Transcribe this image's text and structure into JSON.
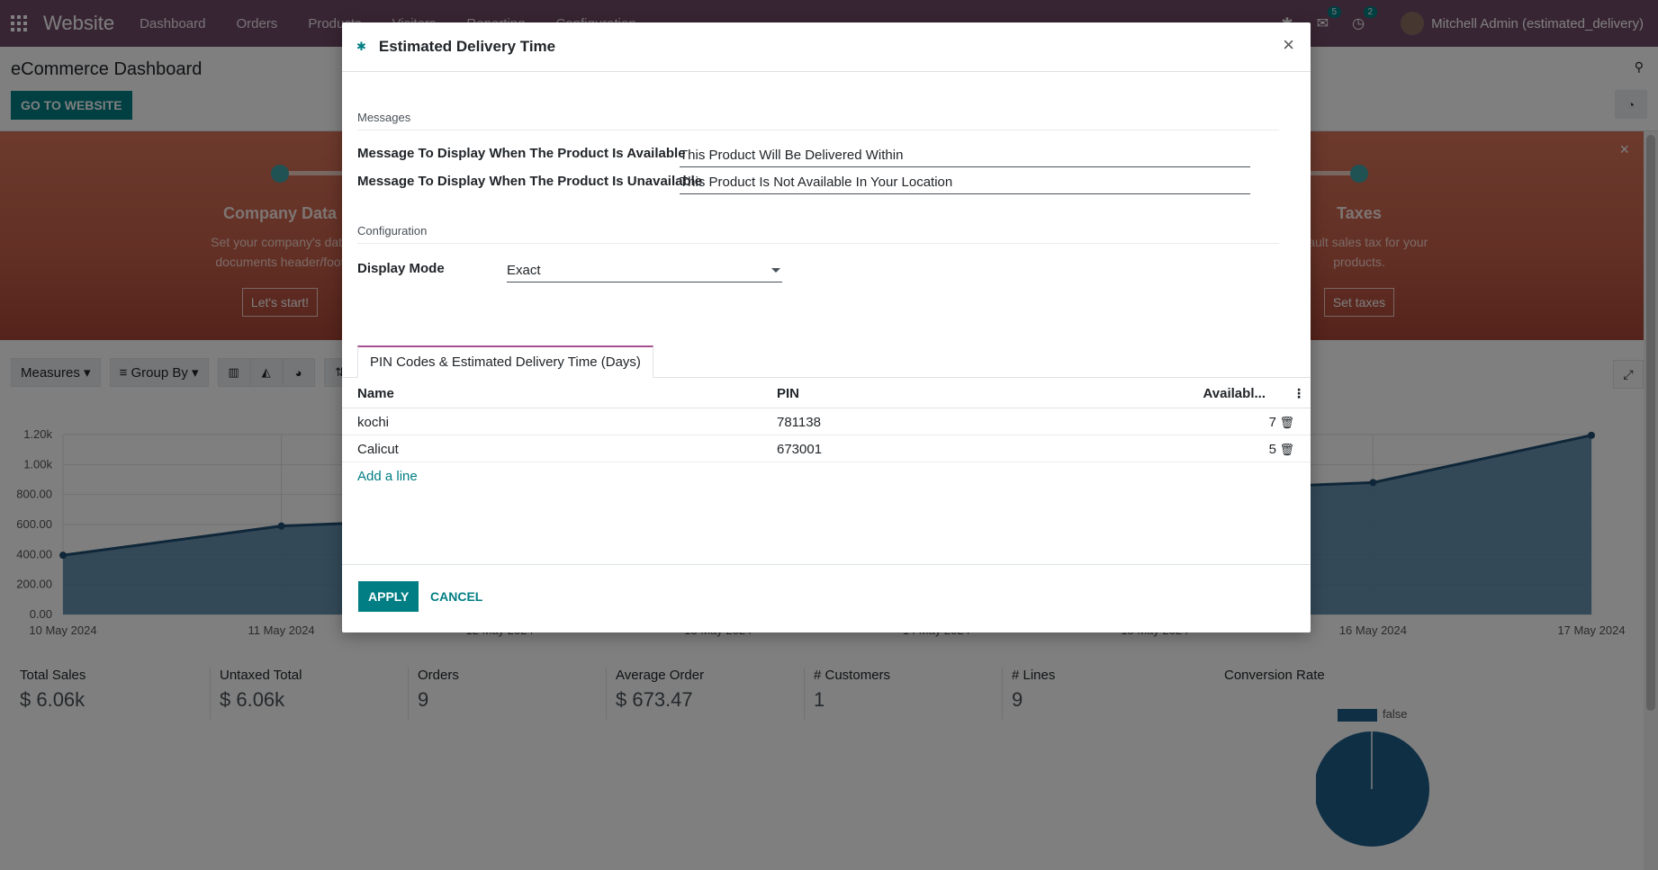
{
  "navbar": {
    "brand": "Website",
    "menu": [
      "Dashboard",
      "Orders",
      "Products",
      "Visitors",
      "Reporting",
      "Configuration"
    ],
    "messages_badge": "5",
    "activity_badge": "2",
    "user": "Mitchell Admin (estimated_delivery)"
  },
  "control_panel": {
    "title": "eCommerce Dashboard",
    "go_to_website": "GO TO WEBSITE"
  },
  "onboarding": {
    "steps": [
      {
        "title": "Company Data",
        "desc_line1": "Set your company's data",
        "desc_line2": "documents header/foot",
        "button": "Let's start!"
      },
      {
        "title": "Taxes",
        "desc_line1": "default sales tax for your",
        "desc_line2": "products.",
        "button": "Set taxes"
      }
    ]
  },
  "toolbar": {
    "measures": "Measures",
    "group_by": "Group By"
  },
  "chart_data": {
    "type": "area",
    "x": [
      "10 May 2024",
      "11 May 2024",
      "12 May 2024",
      "13 May 2024",
      "14 May 2024",
      "15 May 2024",
      "16 May 2024",
      "17 May 2024"
    ],
    "y_ticks": [
      "0.00",
      "200.00",
      "400.00",
      "600.00",
      "800.00",
      "1.00k",
      "1.20k"
    ],
    "ylim": [
      0,
      1200
    ],
    "series": [
      {
        "values": [
          395,
          590,
          null,
          null,
          null,
          null,
          880,
          1195
        ]
      }
    ],
    "color": "#4c7fa3"
  },
  "kpis": [
    {
      "label": "Total Sales",
      "value": "$ 6.06k"
    },
    {
      "label": "Untaxed Total",
      "value": "$ 6.06k"
    },
    {
      "label": "Orders",
      "value": "9"
    },
    {
      "label": "Average Order",
      "value": "$ 673.47"
    },
    {
      "label": "# Customers",
      "value": "1"
    },
    {
      "label": "# Lines",
      "value": "9"
    },
    {
      "label": "Conversion Rate",
      "value": ""
    }
  ],
  "pie": {
    "legend_label": "false",
    "color": "#1f5f8b"
  },
  "modal": {
    "title": "Estimated Delivery Time",
    "messages_section": "Messages",
    "available_label": "Message To Display When The Product Is Available",
    "available_value": "This Product Will Be Delivered Within",
    "unavailable_label": "Message To Display When The Product Is Unavailable",
    "unavailable_value": "This Product Is Not Available In Your Location",
    "configuration_section": "Configuration",
    "display_mode_label": "Display Mode",
    "display_mode_value": "Exact",
    "tab_label": "PIN Codes & Estimated Delivery Time (Days)",
    "columns": {
      "name": "Name",
      "pin": "PIN",
      "avail": "Availabl..."
    },
    "rows": [
      {
        "name": "kochi",
        "pin": "781138",
        "days": "7"
      },
      {
        "name": "Calicut",
        "pin": "673001",
        "days": "5"
      }
    ],
    "add_line": "Add a line",
    "apply": "APPLY",
    "cancel": "CANCEL"
  }
}
